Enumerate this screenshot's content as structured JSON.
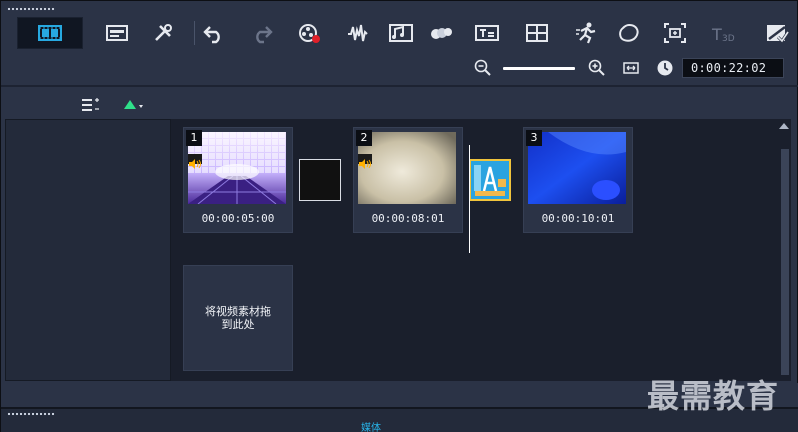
{
  "toolbar": {
    "tools": [
      {
        "name": "storyboard-view-icon",
        "active": true
      },
      {
        "name": "timeline-view-icon"
      },
      {
        "name": "toolbar-customize-icon"
      },
      {
        "name": "undo-icon"
      },
      {
        "name": "redo-icon"
      },
      {
        "name": "record-capture-icon"
      },
      {
        "name": "sound-mixer-icon"
      },
      {
        "name": "auto-music-icon"
      },
      {
        "name": "motion-tracking-icon"
      },
      {
        "name": "subtitle-editor-icon"
      },
      {
        "name": "multi-camera-icon"
      },
      {
        "name": "time-remapping-icon"
      },
      {
        "name": "mask-creator-icon"
      },
      {
        "name": "pan-zoom-icon"
      },
      {
        "name": "3d-title-icon",
        "label": "T3D"
      },
      {
        "name": "split-screen-icon"
      }
    ]
  },
  "zoom": {
    "timecode": "0:00:22:02"
  },
  "left_panel": {},
  "storyboard": {
    "clips": [
      {
        "index": "1",
        "duration": "00:00:05:00"
      },
      {
        "index": "2",
        "duration": "00:00:08:01"
      },
      {
        "index": "3",
        "duration": "00:00:10:01"
      }
    ],
    "placeholder": "将视频素材拖到此处"
  },
  "watermark": "最需教育",
  "bottom_tab": "媒体"
}
